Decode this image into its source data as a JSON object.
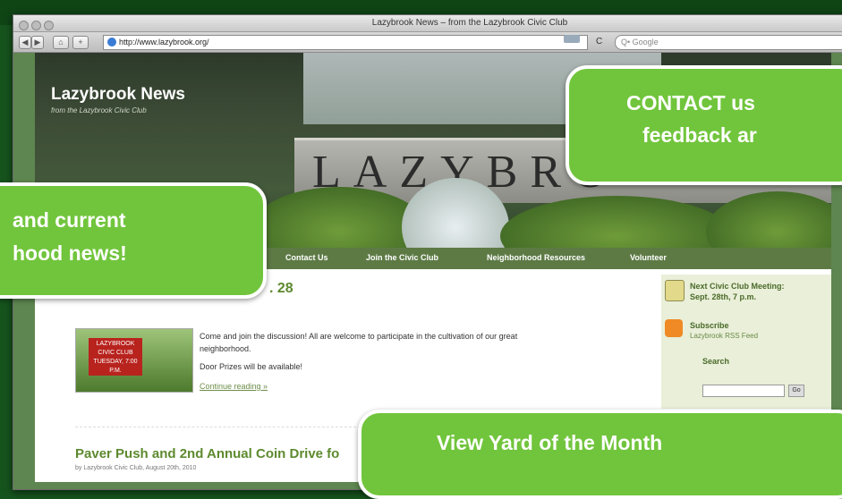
{
  "browser": {
    "window_title": "Lazybrook News – from the Lazybrook Civic Club",
    "url": "http://www.lazybrook.org/",
    "search_placeholder": "Q• Google",
    "back_label": "◀",
    "forward_label": "▶",
    "home_label": "⌂",
    "add_label": "+",
    "reload_label": "C"
  },
  "site": {
    "title": "Lazybrook News",
    "tagline": "from the Lazybrook Civic Club",
    "sign_text": "LAZYBRO"
  },
  "nav": {
    "items": [
      "Contact Us",
      "Join the Civic Club",
      "Neighborhood Resources",
      "Volunteer"
    ]
  },
  "post": {
    "date_fragment": ". 28",
    "thumb_lines": [
      "LAZYBROOK",
      "CIVIC CLUB",
      "TUESDAY, 7:00 P.M."
    ],
    "line1": "Come and join the discussion! All are welcome to participate in the cultivation of our great",
    "line2": "neighborhood.",
    "line3": "Door Prizes will be available!",
    "more": "Continue reading »"
  },
  "post2": {
    "title": "Paver Push and 2nd Annual Coin Drive fo",
    "meta": "by Lazybrook Civic Club, August 20th, 2010"
  },
  "sidebar": {
    "meeting_title": "Next Civic Club Meeting:",
    "meeting_date": "Sept. 28th, 7 p.m.",
    "subscribe_title": "Subscribe",
    "subscribe_sub": "Lazybrook RSS Feed",
    "search_label": "Search",
    "go_label": "Go"
  },
  "callouts": {
    "contact": [
      "CONTACT us",
      "feedback ar"
    ],
    "news": [
      "and current",
      "hood news!"
    ],
    "yard": [
      "View Yard of the Month"
    ]
  },
  "colors": {
    "callout_green": "#71c53c",
    "nav_green": "#5d7a45",
    "background_green": "#16541d"
  }
}
